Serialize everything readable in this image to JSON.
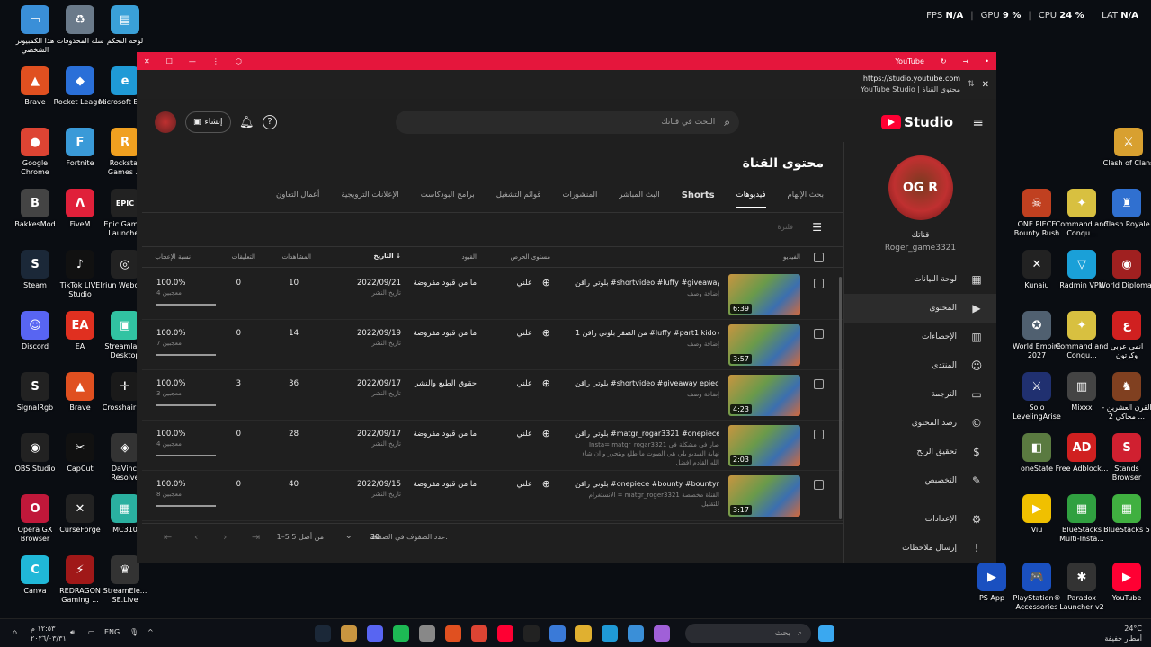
{
  "overlay": {
    "fps_label": "FPS",
    "fps": "N/A",
    "gpu_label": "GPU",
    "gpu": "9 %",
    "cpu_label": "CPU",
    "cpu": "24 %",
    "lat_label": "LAT",
    "lat": "N/A"
  },
  "desktop_left": [
    {
      "label": "هذا الكمبيوتر الشخصي",
      "color": "#3a8fd8",
      "glyph": "▭"
    },
    {
      "label": "سلة المحذوفات",
      "color": "#6a7a8a",
      "glyph": "♻"
    },
    {
      "label": "لوحة التحكم",
      "color": "#3aa0d8",
      "glyph": "▤"
    },
    {
      "label": "Brave",
      "color": "#e05020",
      "glyph": "▲"
    },
    {
      "label": "Rocket League",
      "color": "#2a6fd8",
      "glyph": "◆"
    },
    {
      "label": "Microsoft Edge",
      "color": "#1f9ad6",
      "glyph": "e"
    },
    {
      "label": "Google Chrome",
      "color": "#dd4433",
      "glyph": "●"
    },
    {
      "label": "Fortnite",
      "color": "#3a9ad8",
      "glyph": "F"
    },
    {
      "label": "Rockstar Games ...",
      "color": "#f0a020",
      "glyph": "R"
    },
    {
      "label": "BakkesMod",
      "color": "#444",
      "glyph": "B"
    },
    {
      "label": "FiveM",
      "color": "#e0203a",
      "glyph": "Λ"
    },
    {
      "label": "Epic Games Launcher",
      "color": "#222",
      "glyph": "EPIC"
    },
    {
      "label": "Steam",
      "color": "#1b2838",
      "glyph": "S"
    },
    {
      "label": "TikTok LIVE Studio",
      "color": "#111",
      "glyph": "♪"
    },
    {
      "label": "Iriun Webcam",
      "color": "#222",
      "glyph": "◎"
    },
    {
      "label": "Discord",
      "color": "#5865f2",
      "glyph": "☺"
    },
    {
      "label": "EA",
      "color": "#e03020",
      "glyph": "EA"
    },
    {
      "label": "Streamlabs Desktop",
      "color": "#31c3a2",
      "glyph": "▣"
    },
    {
      "label": "SignalRgb",
      "color": "#222",
      "glyph": "S"
    },
    {
      "label": "Brave",
      "color": "#e05020",
      "glyph": "▲"
    },
    {
      "label": "Crosshair V2",
      "color": "#1a1a1a",
      "glyph": "✛"
    },
    {
      "label": "OBS Studio",
      "color": "#222",
      "glyph": "◉"
    },
    {
      "label": "CapCut",
      "color": "#111",
      "glyph": "✂"
    },
    {
      "label": "DaVinci Resolve",
      "color": "#333",
      "glyph": "◈"
    },
    {
      "label": "Opera GX Browser",
      "color": "#c0183a",
      "glyph": "O"
    },
    {
      "label": "CurseForge",
      "color": "#222",
      "glyph": "✕"
    },
    {
      "label": "MC310",
      "color": "#2ab0a0",
      "glyph": "▦"
    },
    {
      "label": "Canva",
      "color": "#20b8d8",
      "glyph": "C"
    },
    {
      "label": "REDRAGON Gaming ...",
      "color": "#a01818",
      "glyph": "⚡"
    },
    {
      "label": "StreamEle... SE.Live",
      "color": "#333",
      "glyph": "♛"
    }
  ],
  "desktop_right": [
    {
      "label": "Clash of Clans",
      "color": "#d8a030",
      "glyph": "⚔"
    },
    {
      "label": "ONE PIECE Bounty Rush",
      "color": "#c04020",
      "glyph": "☠"
    },
    {
      "label": "Command and Conqu...",
      "color": "#d8c040",
      "glyph": "✦"
    },
    {
      "label": "Clash Royale",
      "color": "#3070d0",
      "glyph": "♜"
    },
    {
      "label": "Kunaiu",
      "color": "#222",
      "glyph": "✕"
    },
    {
      "label": "Radmin VPN",
      "color": "#1aa0d8",
      "glyph": "▽"
    },
    {
      "label": "World Diplomat",
      "color": "#a02020",
      "glyph": "◉"
    },
    {
      "label": "World Empire 2027",
      "color": "#506070",
      "glyph": "✪"
    },
    {
      "label": "Command and Conqu...",
      "color": "#d8c040",
      "glyph": "✦"
    },
    {
      "label": "انمي عربي وكرتون",
      "color": "#d02020",
      "glyph": "ع"
    },
    {
      "label": "Solo LevelingArise",
      "color": "#203070",
      "glyph": "⚔"
    },
    {
      "label": "Mixxx",
      "color": "#444",
      "glyph": "▥"
    },
    {
      "label": "القرن العشرين - محاكي 2 ...",
      "color": "#804020",
      "glyph": "♞"
    },
    {
      "label": "oneState",
      "color": "#5a7a40",
      "glyph": "◧"
    },
    {
      "label": "Free Adblock...",
      "color": "#d02020",
      "glyph": "AD"
    },
    {
      "label": "Stands Browser",
      "color": "#d02030",
      "glyph": "S"
    },
    {
      "label": "Viu",
      "color": "#f0c000",
      "glyph": "▶"
    },
    {
      "label": "BlueStacks Multi-Insta...",
      "color": "#30a040",
      "glyph": "▦"
    },
    {
      "label": "BlueStacks 5",
      "color": "#40b040",
      "glyph": "▦"
    },
    {
      "label": "PS App",
      "color": "#1a50c0",
      "glyph": "▶"
    },
    {
      "label": "PlayStation® Accessories",
      "color": "#1a50c0",
      "glyph": "🎮"
    },
    {
      "label": "Paradox Launcher v2",
      "color": "#333",
      "glyph": "✱"
    },
    {
      "label": "YouTube",
      "color": "#ff0033",
      "glyph": "▶"
    }
  ],
  "browser": {
    "tab_label": "YouTube",
    "url": "https://studio.youtube.com",
    "page_title": "YouTube Studio | محتوى القناة"
  },
  "studio": {
    "logo_text": "Studio",
    "search_placeholder": "البحث في قناتك",
    "create_label": "إنشاء",
    "sidebar": {
      "channel_label": "قناتك",
      "channel_handle": "Roger_game3321",
      "avatar_text": "OG R",
      "items": [
        {
          "label": "لوحة البيانات",
          "icon": "dashboard-icon",
          "glyph": "▦"
        },
        {
          "label": "المحتوى",
          "icon": "content-icon",
          "glyph": "▶"
        },
        {
          "label": "الإحصاءات",
          "icon": "analytics-icon",
          "glyph": "▥"
        },
        {
          "label": "المنتدى",
          "icon": "community-icon",
          "glyph": "☺"
        },
        {
          "label": "الترجمة",
          "icon": "subtitles-icon",
          "glyph": "▭"
        },
        {
          "label": "رصد المحتوى",
          "icon": "copyright-icon",
          "glyph": "©"
        },
        {
          "label": "تحقيق الربح",
          "icon": "earn-icon",
          "glyph": "$"
        },
        {
          "label": "التخصيص",
          "icon": "customize-icon",
          "glyph": "✎"
        }
      ],
      "settings_label": "الإعدادات",
      "feedback_label": "إرسال ملاحظات"
    },
    "main": {
      "title": "محتوى القناة",
      "tabs": [
        {
          "label": "بحث الإلهام",
          "active": false
        },
        {
          "label": "فيديوهات",
          "active": true
        },
        {
          "label": "Shorts",
          "active": false
        },
        {
          "label": "البث المباشر",
          "active": false
        },
        {
          "label": "المنشورات",
          "active": false
        },
        {
          "label": "قوائم التشغيل",
          "active": false
        },
        {
          "label": "برامج البودكاست",
          "active": false
        },
        {
          "label": "الإعلانات الترويجية",
          "active": false
        },
        {
          "label": "أعمال التعاون",
          "active": false
        }
      ],
      "filter_label": "فلترة",
      "columns": {
        "video": "الفيديو",
        "visibility": "مستوى الحرص",
        "restrictions": "القيود",
        "date": "التاريخ",
        "views": "المشاهدات",
        "comments": "التعليقات",
        "likes": "نسبة الإعجاب"
      },
      "rows": [
        {
          "title": "بلوتي راقن #shortvideo #luffy #giveaway...",
          "desc": "إضافة وصف",
          "duration": "6:39",
          "visibility": "علني",
          "restriction": "ما من قيود مفروضة",
          "date": "2022/09/21",
          "date_sub": "تاريخ النشر",
          "views": "10",
          "comments": "0",
          "likes": "100.0%",
          "likes_sub": "4 معجبين",
          "like_fraction": 1.0
        },
        {
          "title": "من الصفر بلوتي راقن 1 #luffy #part1 kido o...",
          "desc": "إضافة وصف",
          "duration": "3:57",
          "visibility": "علني",
          "restriction": "ما من قيود مفروضة",
          "date": "2022/09/19",
          "date_sub": "تاريخ النشر",
          "views": "14",
          "comments": "0",
          "likes": "100.0%",
          "likes_sub": "7 معجبين",
          "like_fraction": 1.0
        },
        {
          "title": "بلوتي راقن #shortvideo #giveaway epiece...",
          "desc": "إضافة وصف",
          "duration": "4:23",
          "visibility": "علني",
          "restriction": "حقوق الطبع والنشر",
          "date": "2022/09/17",
          "date_sub": "تاريخ النشر",
          "views": "36",
          "comments": "3",
          "likes": "100.0%",
          "likes_sub": "3 معجبين",
          "like_fraction": 1.0
        },
        {
          "title": "بلوتي راقن #matgr_rogar3321 #onepiece ...",
          "desc": "Insta= matgr_rogar3321 صار في مشكلة في نهاية الفيديو يلي هي الصوت ما طلع وبتحرر و ان شاء الله القادم افضل",
          "duration": "2:03",
          "visibility": "علني",
          "restriction": "ما من قيود مفروضة",
          "date": "2022/09/17",
          "date_sub": "تاريخ النشر",
          "views": "28",
          "comments": "0",
          "likes": "100.0%",
          "likes_sub": "4 معجبين",
          "like_fraction": 1.0
        },
        {
          "title": "بلوتي راقن #onepiece #bounty #bountyrush...",
          "desc": "الانستغرام = matgr_roger3321 القناة مخصصة للتقليل",
          "duration": "3:17",
          "visibility": "علني",
          "restriction": "ما من قيود مفروضة",
          "date": "2022/09/15",
          "date_sub": "تاريخ النشر",
          "views": "40",
          "comments": "0",
          "likes": "100.0%",
          "likes_sub": "8 معجبين",
          "like_fraction": 1.0
        }
      ],
      "pagination": {
        "rows_label": "عدد الصفوف في الصفحة:",
        "rows_per_page": "30",
        "range": "1–5 من أصل 5"
      }
    }
  },
  "taskbar": {
    "search_placeholder": "بحث",
    "lang": "ENG",
    "time": "١٢:٥٣ م",
    "date": "٢٠٢٦/٠٣/٣١",
    "weather_temp": "24°C",
    "weather_desc": "أمطار خفيفة"
  }
}
